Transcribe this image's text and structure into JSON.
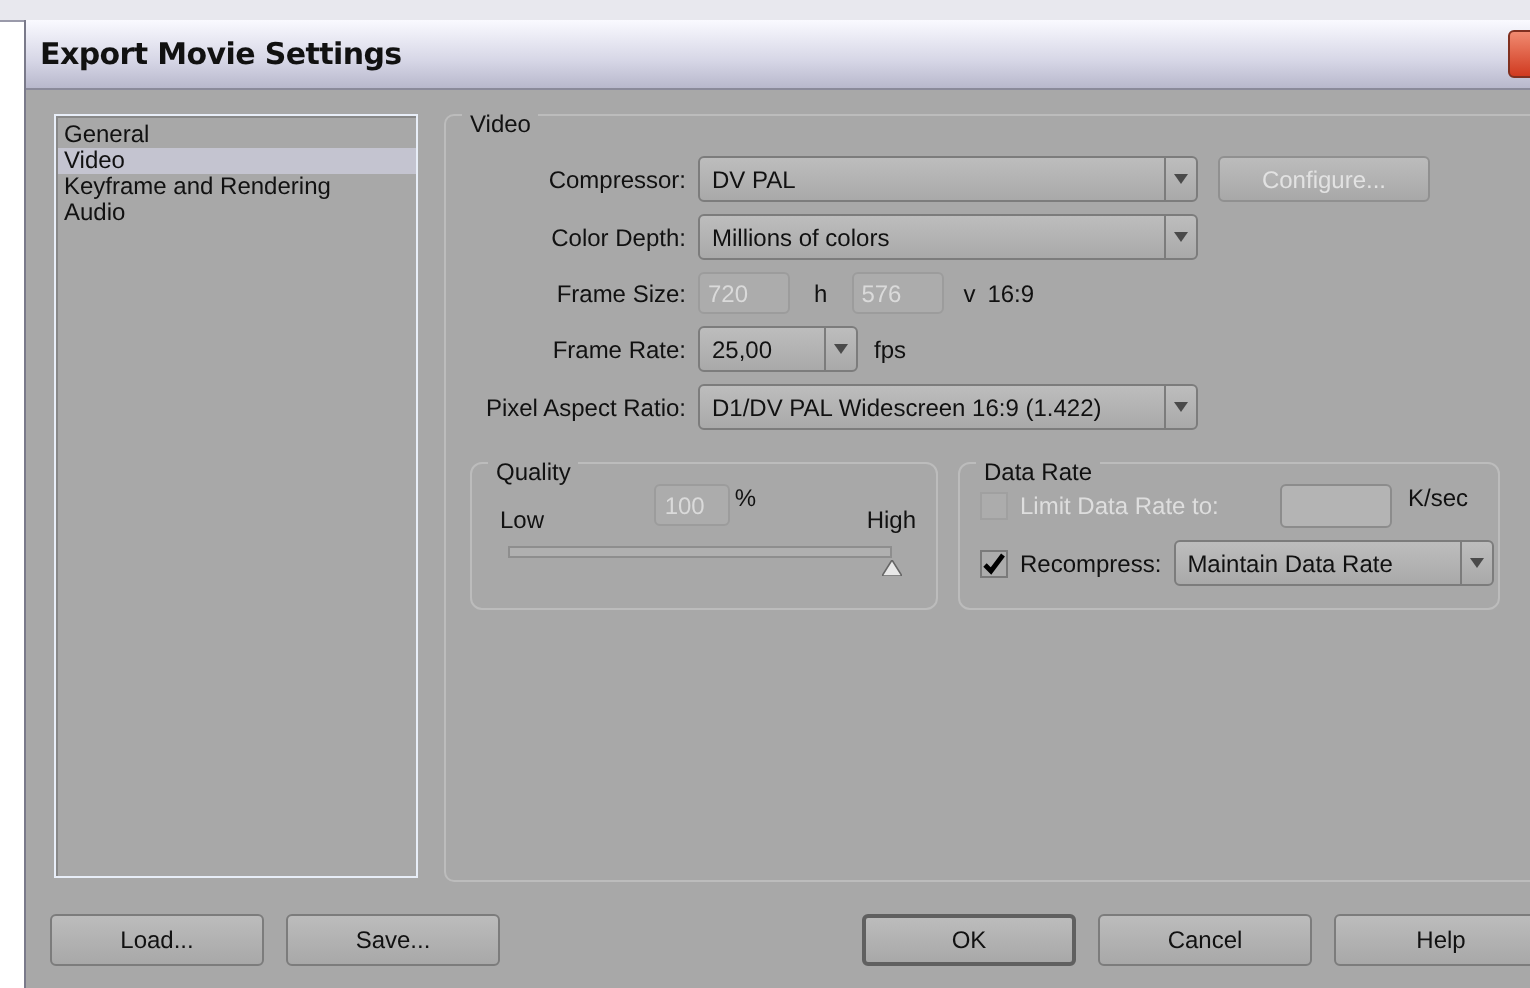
{
  "window": {
    "title": "Export Movie Settings"
  },
  "sidebar": {
    "items": [
      {
        "label": "General",
        "selected": false
      },
      {
        "label": "Video",
        "selected": true
      },
      {
        "label": "Keyframe and Rendering",
        "selected": false
      },
      {
        "label": "Audio",
        "selected": false
      }
    ]
  },
  "video": {
    "title": "Video",
    "compressor": {
      "label": "Compressor:",
      "value": "DV PAL",
      "button": {
        "label": "Configure...",
        "disabled": true
      }
    },
    "color_depth": {
      "label": "Color Depth:",
      "value": "Millions of colors"
    },
    "frame_size": {
      "label": "Frame Size:",
      "width": {
        "value": "720",
        "disabled": true
      },
      "width_unit": "h",
      "height": {
        "value": "576",
        "disabled": true
      },
      "height_unit": "v",
      "aspect": "16:9"
    },
    "frame_rate": {
      "label": "Frame Rate:",
      "value": "25,00",
      "unit": "fps"
    },
    "pixel_aspect_ratio": {
      "label": "Pixel Aspect Ratio:",
      "value": "D1/DV PAL Widescreen 16:9 (1.422)"
    },
    "quality": {
      "title": "Quality",
      "low": "Low",
      "high": "High",
      "value": "100",
      "unit": "%",
      "disabled": true,
      "level": 1
    },
    "data_rate": {
      "title": "Data Rate",
      "limit": {
        "label": "Limit Data Rate to:",
        "checked": false,
        "disabled": true,
        "unit": "K/sec"
      },
      "recompress": {
        "label": "Recompress:",
        "checked": true,
        "disabled": false,
        "value": "Maintain Data Rate"
      }
    }
  },
  "buttons_left": [
    {
      "label": "Load...",
      "default": false
    },
    {
      "label": "Save...",
      "default": false
    }
  ],
  "buttons_right": [
    {
      "label": "OK",
      "default": true
    },
    {
      "label": "Cancel",
      "default": false
    },
    {
      "label": "Help",
      "default": false
    }
  ]
}
